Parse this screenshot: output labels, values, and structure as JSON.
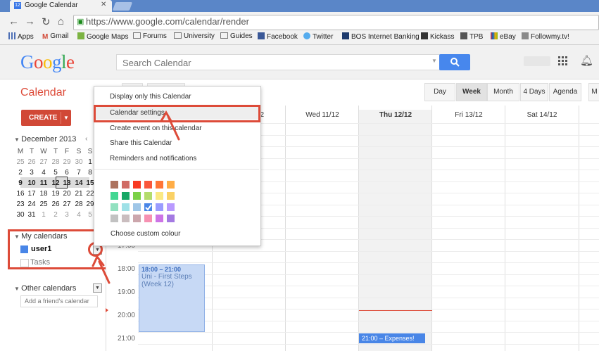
{
  "browser": {
    "tab_title": "Google Calendar",
    "tab_favicon_text": "12",
    "url": "https://www.google.com/calendar/render",
    "bookmarks": [
      "Apps",
      "Gmail",
      "Google Maps",
      "Forums",
      "University",
      "Guides",
      "Facebook",
      "Twitter",
      "BOS Internet Banking",
      "Kickass",
      "TPB",
      "eBay",
      "Followmy.tv!"
    ]
  },
  "header": {
    "logo": "Google",
    "search_placeholder": "Search Calendar"
  },
  "toolbar": {
    "title": "Calendar",
    "views": [
      "Day",
      "Week",
      "Month",
      "4 Days",
      "Agenda",
      "M"
    ],
    "selected_view": "Week"
  },
  "sidebar": {
    "create_label": "CREATE",
    "mini_calendar": {
      "title": "December 2013",
      "weekdays": [
        "M",
        "T",
        "W",
        "T",
        "F",
        "S",
        "S"
      ],
      "weeks": [
        [
          "25",
          "26",
          "27",
          "28",
          "29",
          "30",
          "1"
        ],
        [
          "2",
          "3",
          "4",
          "5",
          "6",
          "7",
          "8"
        ],
        [
          "9",
          "10",
          "11",
          "12",
          "13",
          "14",
          "15"
        ],
        [
          "16",
          "17",
          "18",
          "19",
          "20",
          "21",
          "22"
        ],
        [
          "23",
          "24",
          "25",
          "26",
          "27",
          "28",
          "29"
        ],
        [
          "30",
          "31",
          "1",
          "2",
          "3",
          "4",
          "5"
        ]
      ],
      "today": "12"
    },
    "my_calendars_label": "My calendars",
    "calendars": [
      {
        "label": "user1",
        "color": "#4986e7"
      },
      {
        "label": "Tasks",
        "color": "#ffffff"
      }
    ],
    "other_calendars_label": "Other calendars",
    "friend_placeholder": "Add a friend's calendar"
  },
  "grid": {
    "day_headers": [
      "Wed 11/12",
      "Thu 12/12",
      "Fri 13/12",
      "Sat 14/12"
    ],
    "partial_header": "2",
    "hours": [
      "17:00",
      "18:00",
      "19:00",
      "20:00",
      "21:00"
    ],
    "events": [
      {
        "time": "18:00 – 21:00",
        "title": "Uni - First Steps (Week 12)"
      },
      {
        "time": "21:00",
        "title": "Expenses!"
      }
    ],
    "event2_label": "21:00 – Expenses!"
  },
  "menu": {
    "items": [
      "Display only this Calendar",
      "Calendar settings",
      "Create event on this calendar",
      "Share this Calendar",
      "Reminders and notifications"
    ],
    "custom_colour": "Choose custom colour",
    "swatches": [
      [
        "#ac725e",
        "#d06b64",
        "#f83a22",
        "#fa573c",
        "#ff7537",
        "#ffad46"
      ],
      [
        "#42d692",
        "#16a765",
        "#7bd148",
        "#b3dc6c",
        "#fbe983",
        "#fad165"
      ],
      [
        "#92e1c0",
        "#9fe1e7",
        "#9fc6e7",
        "#4986e7",
        "#9a9cff",
        "#b99aff"
      ],
      [
        "#c2c2c2",
        "#cabdbf",
        "#cca6ac",
        "#f691b2",
        "#cd74e6",
        "#a47ae2"
      ]
    ],
    "selected_swatch": "#4986e7"
  },
  "colors": {
    "accent_red": "#dd4b39",
    "event_blue": "#4986e7",
    "button_blue": "#4787ed"
  }
}
